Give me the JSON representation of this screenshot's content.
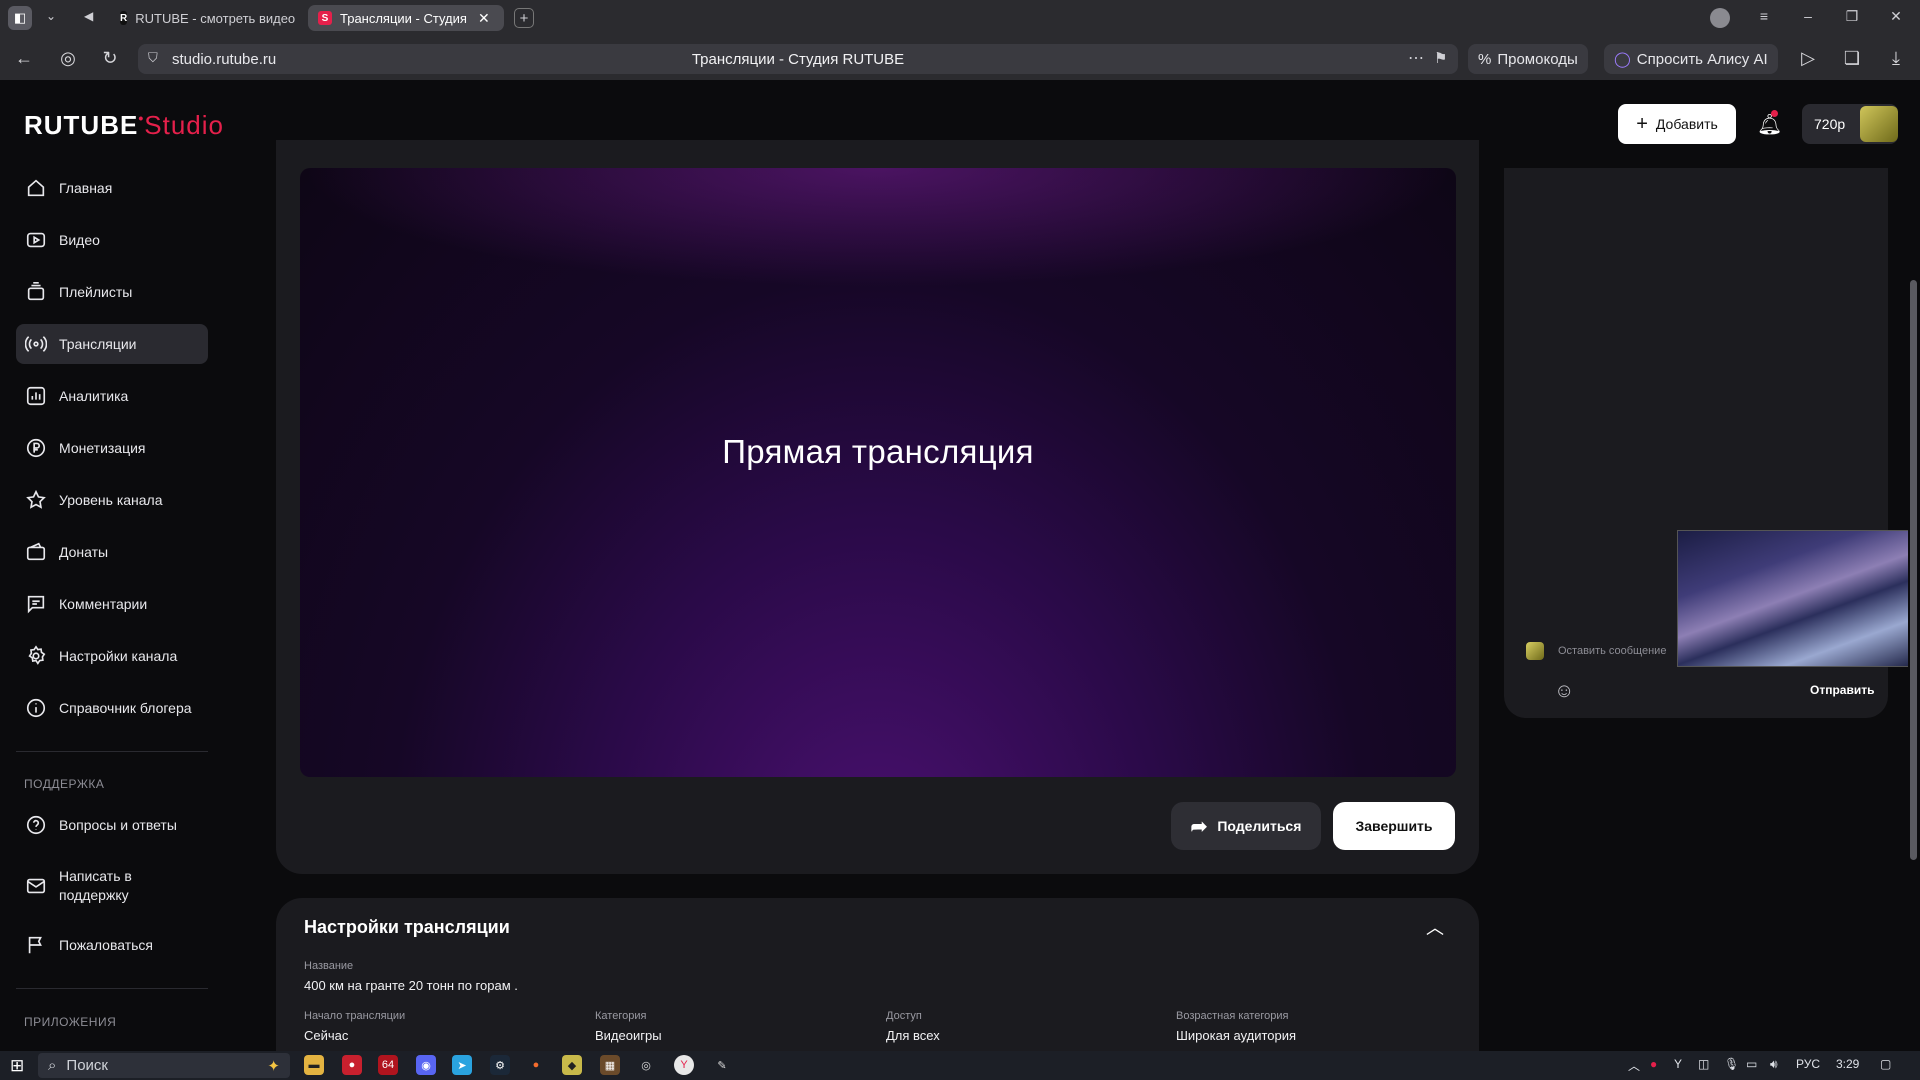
{
  "browser": {
    "tabs": [
      {
        "label": "RUTUBE - смотреть видео",
        "favicon": "R"
      },
      {
        "label": "Трансляции - Студия RUTUBE",
        "favicon": "S"
      }
    ],
    "url": "studio.rutube.ru",
    "page_title": "Трансляции - Студия RUTUBE",
    "promo_label": "Промокоды",
    "alice_label": "Спросить Алису AI"
  },
  "app": {
    "logo_main": "RUTUBE",
    "logo_studio": "Studio",
    "add_button": "Добавить",
    "resolution": "720p"
  },
  "sidebar": {
    "items": [
      {
        "label": "Главная",
        "icon": "home-icon"
      },
      {
        "label": "Видео",
        "icon": "video-icon"
      },
      {
        "label": "Плейлисты",
        "icon": "playlist-icon"
      },
      {
        "label": "Трансляции",
        "icon": "broadcast-icon"
      },
      {
        "label": "Аналитика",
        "icon": "analytics-icon"
      },
      {
        "label": "Монетизация",
        "icon": "ruble-icon"
      },
      {
        "label": "Уровень канала",
        "icon": "star-icon"
      },
      {
        "label": "Донаты",
        "icon": "wallet-icon"
      },
      {
        "label": "Комментарии",
        "icon": "comment-icon"
      },
      {
        "label": "Настройки канала",
        "icon": "gear-icon"
      },
      {
        "label": "Справочник блогера",
        "icon": "info-icon"
      }
    ],
    "support_title": "ПОДДЕРЖКА",
    "support_items": [
      {
        "label": "Вопросы и ответы",
        "icon": "question-icon"
      },
      {
        "label": "Написать в поддержку",
        "icon": "mail-icon"
      },
      {
        "label": "Пожаловаться",
        "icon": "flag-icon"
      }
    ],
    "apps_title": "ПРИЛОЖЕНИЯ"
  },
  "stream": {
    "title": "Прямая трансляция",
    "share_button": "Поделиться",
    "finish_button": "Завершить"
  },
  "chat": {
    "placeholder": "Оставить сообщение",
    "send_button": "Отправить"
  },
  "settings": {
    "title": "Настройки трансляции",
    "name_label": "Название",
    "name_value": "400 км на гранте 20 тонн по горам .",
    "start_label": "Начало трансляции",
    "start_value": "Сейчас",
    "category_label": "Категория",
    "category_value": "Видеоигры",
    "access_label": "Доступ",
    "access_value": "Для всех",
    "age_label": "Возрастная категория",
    "age_value": "Широкая аудитория"
  },
  "taskbar": {
    "search_placeholder": "Поиск",
    "lang": "РУС",
    "time": "3:29"
  },
  "colors": {
    "accent": "#e5204b",
    "bg": "#0b0b0d",
    "card": "#1b1b1f"
  }
}
